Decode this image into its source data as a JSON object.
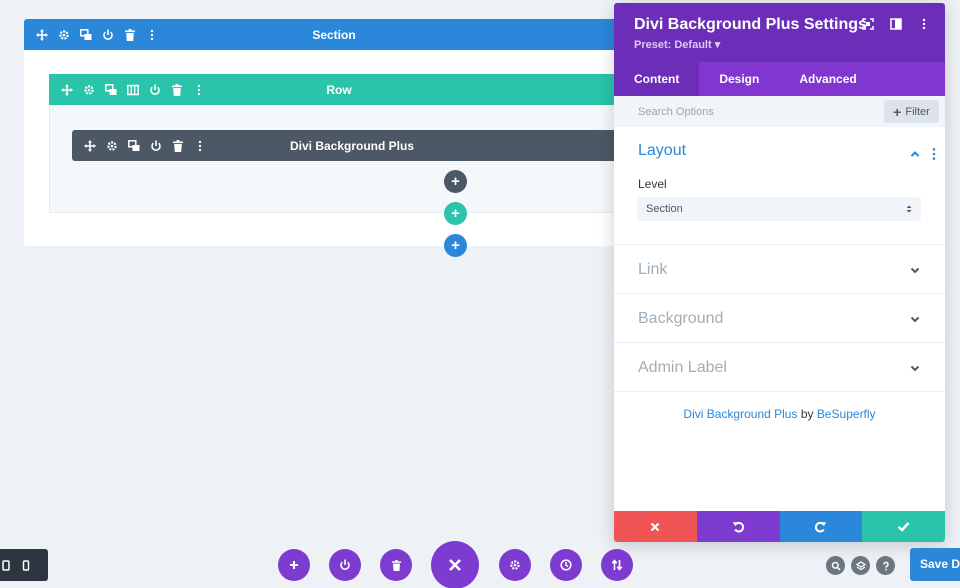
{
  "builder": {
    "section_label": "Section",
    "row_label": "Row",
    "module_label": "Divi Background Plus",
    "add_glyph": "+"
  },
  "panel": {
    "title": "Divi Background Plus Settings",
    "preset": "Preset: Default ▾",
    "tabs": [
      {
        "label": "Content",
        "active": true
      },
      {
        "label": "Design",
        "active": false
      },
      {
        "label": "Advanced",
        "active": false
      }
    ],
    "search_placeholder": "Search Options",
    "filter_label": "Filter",
    "groups": {
      "layout": "Layout",
      "link": "Link",
      "background": "Background",
      "admin_label": "Admin Label"
    },
    "level_label": "Level",
    "level_value": "Section",
    "credit": {
      "product": "Divi Background Plus",
      "by": "by",
      "author": "BeSuperfly"
    }
  },
  "toolbar": {
    "save_label": "Save Draft"
  },
  "colors": {
    "section": "#2b87da",
    "row": "#29c4a9",
    "module": "#4c5866",
    "panel_header": "#6c2eb9",
    "tab_bar": "#8036cf",
    "discard": "#ef5555",
    "undo": "#7e3bd0",
    "redo": "#2b87da",
    "confirm": "#29c4a9"
  },
  "icons": [
    "move-icon",
    "gear-icon",
    "duplicate-icon",
    "columns-icon",
    "power-icon",
    "trash-icon",
    "more-icon",
    "fullscreen-icon",
    "split-view-icon",
    "chevron-down-icon",
    "chevron-up-icon",
    "close-icon",
    "undo-icon",
    "redo-icon",
    "check-icon",
    "history-icon",
    "portability-icon",
    "search-icon",
    "layers-icon",
    "help-icon",
    "tablet-icon",
    "phone-icon"
  ]
}
